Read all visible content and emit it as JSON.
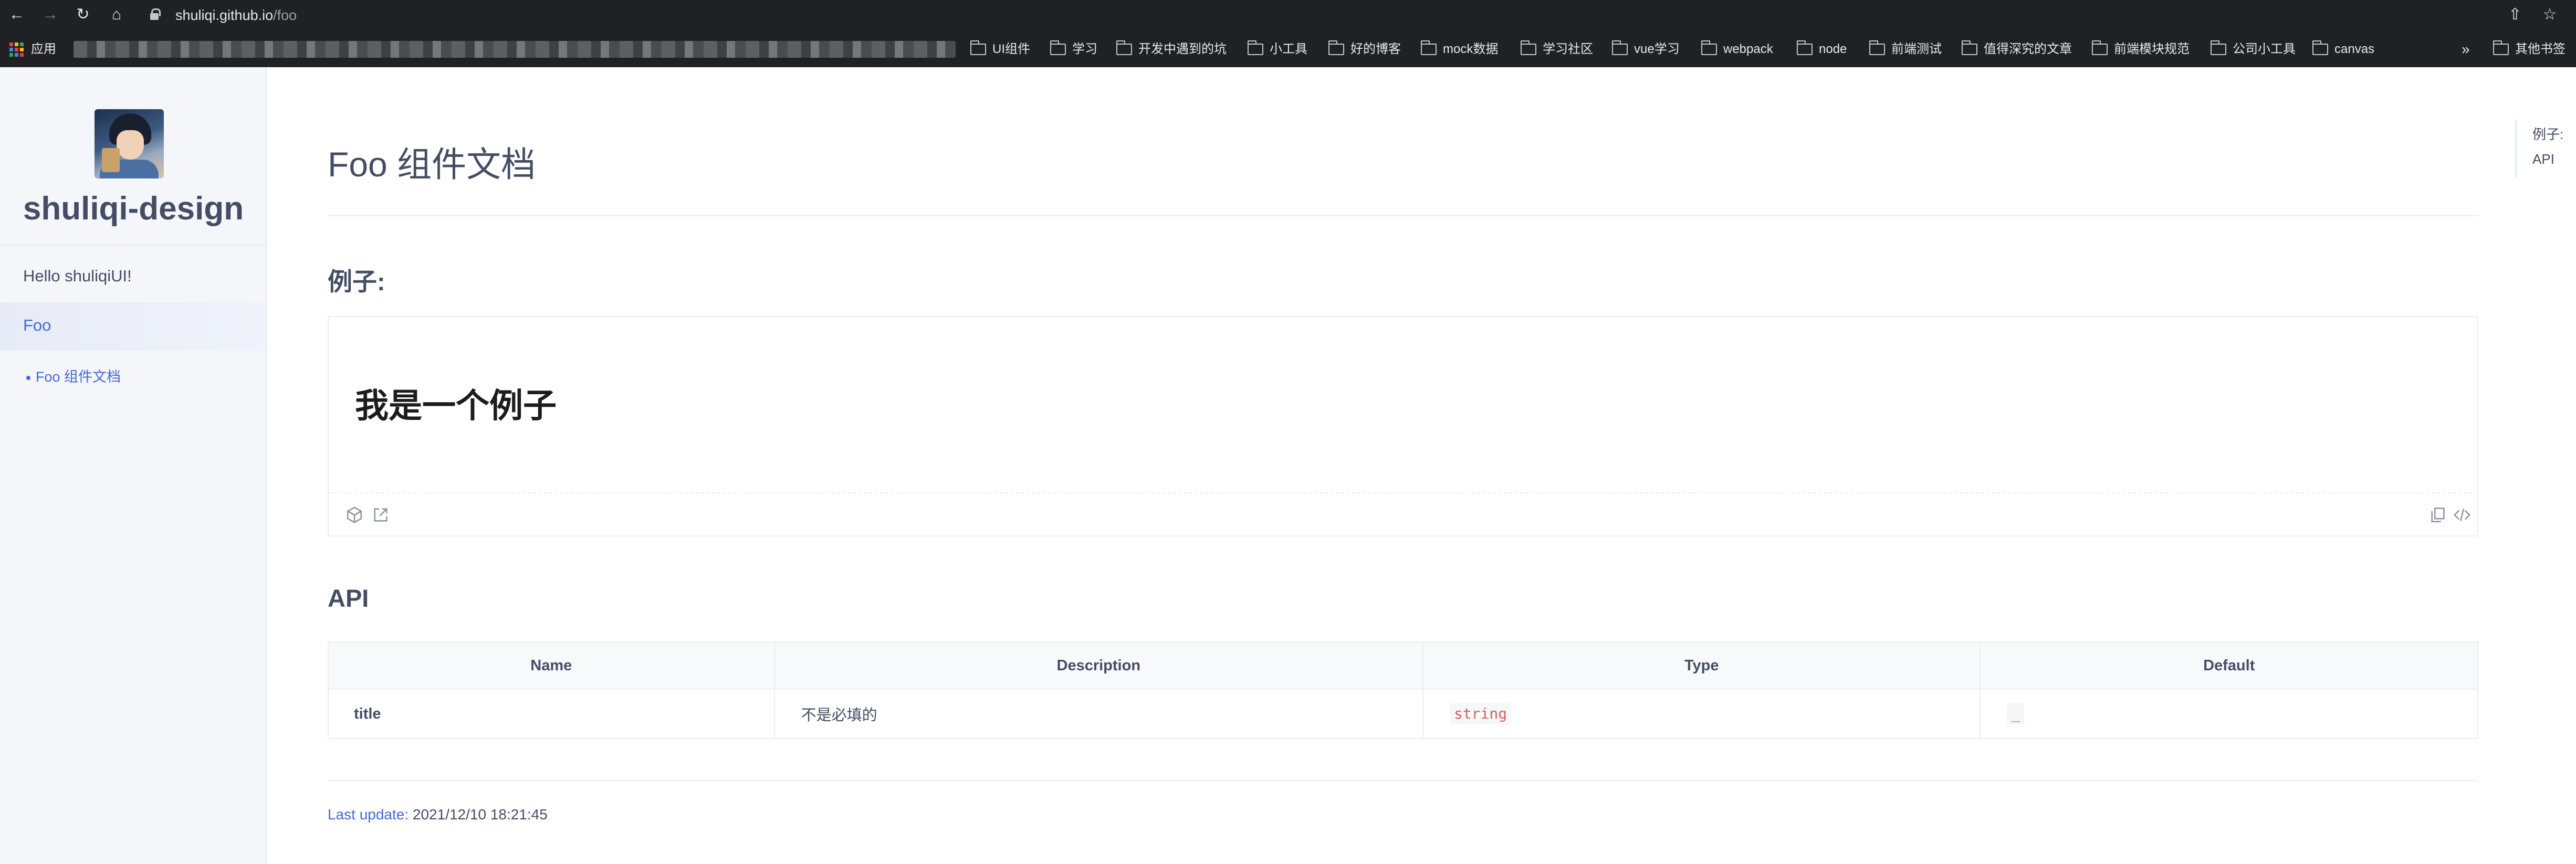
{
  "browser": {
    "url_host": "shuliqi.github.io",
    "url_path": "/foo",
    "apps_label": "应用",
    "bookmarks": [
      "UI组件",
      "学习",
      "开发中遇到的坑",
      "小工具",
      "好的博客",
      "mock数据",
      "学习社区",
      "vue学习",
      "webpack",
      "node",
      "前端测试",
      "值得深究的文章",
      "前端模块规范",
      "公司小工具",
      "canvas"
    ],
    "more_label": "»",
    "other_bookmarks": "其他书签",
    "icons": [
      "back-icon",
      "forward-icon",
      "reload-icon",
      "home-icon",
      "lock-icon",
      "share-icon",
      "star-icon"
    ]
  },
  "sidebar": {
    "site_title": "shuliqi-design",
    "links": [
      {
        "label": "Hello shuliqiUI!"
      },
      {
        "label": "Foo",
        "active": true
      }
    ],
    "sub_links": [
      {
        "label": "Foo 组件文档"
      }
    ]
  },
  "main": {
    "title": "Foo 组件文档",
    "example_heading": "例子:",
    "demo_text": "我是一个例子",
    "demo_actions": [
      "codesandbox-icon",
      "external-link-icon",
      "copy-icon",
      "code-icon"
    ],
    "api_heading": "API",
    "api_table": {
      "headers": [
        "Name",
        "Description",
        "Type",
        "Default"
      ],
      "rows": [
        {
          "name": "title",
          "description": "不是必填的",
          "type": "string",
          "default": "_"
        }
      ]
    },
    "last_update_label": "Last update:",
    "last_update_value": "2021/12/10 18:21:45"
  },
  "toc": {
    "items": [
      "例子:",
      "API"
    ]
  },
  "colors": {
    "accent": "#4569d4",
    "text": "#454d64",
    "code": "#d56161",
    "chrome_bg": "#202124"
  }
}
